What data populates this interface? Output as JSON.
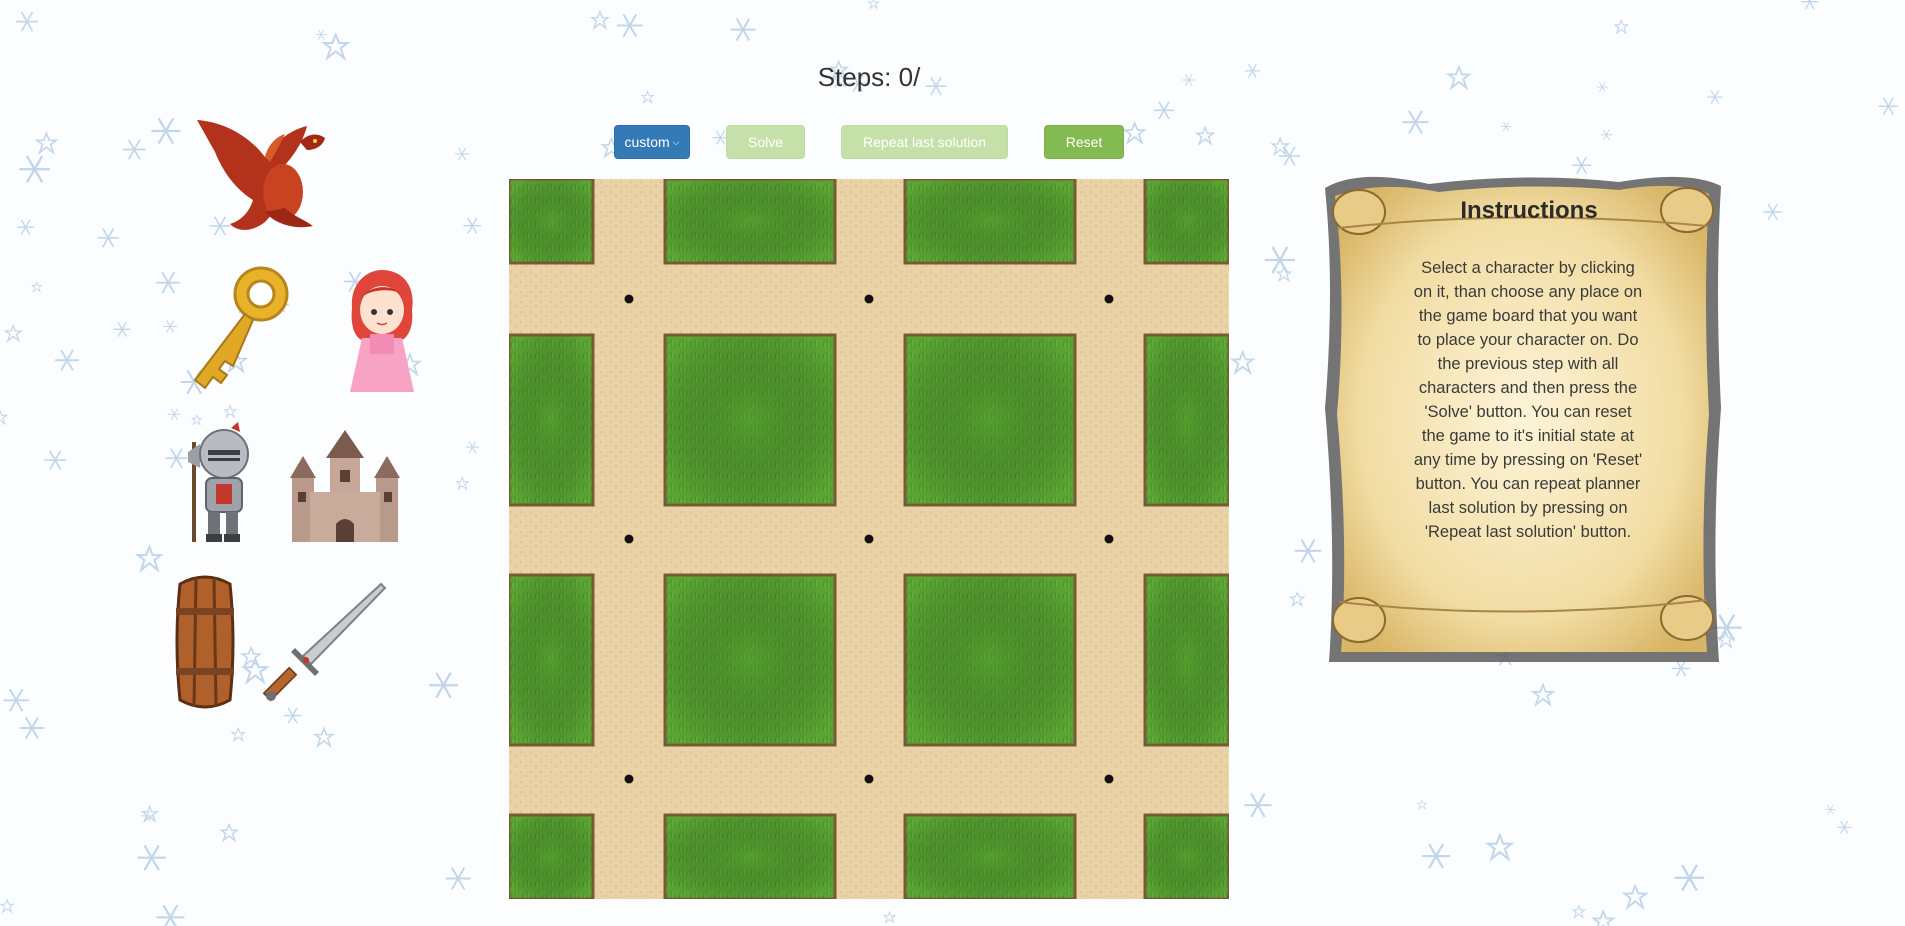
{
  "steps": {
    "text": "Steps: 0/"
  },
  "toolbar": {
    "custom_label": "custom",
    "solve_label": "Solve",
    "repeat_label": "Repeat last solution",
    "reset_label": "Reset"
  },
  "characters": [
    "dragon",
    "key",
    "princess",
    "knight",
    "castle",
    "barrel",
    "sword"
  ],
  "board": {
    "grass_rows": 4,
    "grass_cols": 4,
    "path_dots": 9
  },
  "instructions": {
    "title": "Instructions",
    "body": "Select a character by clicking on it, than choose any place on the game board that you want to place your character on. Do the previous step with all characters and then press the 'Solve' button. You can reset the game to it's initial state at any time by pressing on 'Reset' button. You can repeat planner last solution by pressing on 'Repeat last solution' button."
  },
  "colors": {
    "custom_button": "#337ab7",
    "disabled_button": "#c5e1a9",
    "reset_button": "#83bb52",
    "grass": "#55a32f",
    "path": "#e8cfa2"
  }
}
